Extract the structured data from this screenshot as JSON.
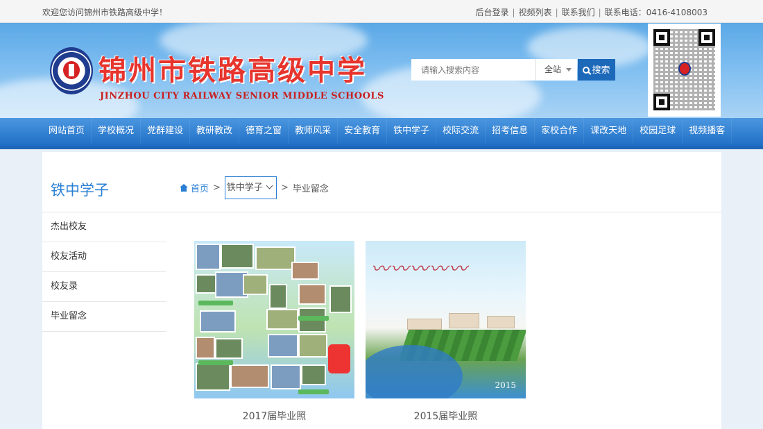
{
  "topbar": {
    "welcome": "欢迎您访问锦州市铁路高级中学！",
    "links": [
      "后台登录",
      "视频列表",
      "联系我们",
      "联系电话：0416-4108003"
    ]
  },
  "header": {
    "school_name": "锦州市铁路高级中学",
    "school_name_en": "JINZHOU CITY RAILWAY SENIOR MIDDLE SCHOOLS"
  },
  "search": {
    "placeholder": "请输入搜索内容",
    "scope": "全站",
    "button_label": "搜索"
  },
  "nav": {
    "items": [
      "网站首页",
      "学校概况",
      "党群建设",
      "教研教改",
      "德育之窗",
      "教师风采",
      "安全教育",
      "铁中学子",
      "校际交流",
      "招考信息",
      "家校合作",
      "课改天地",
      "校园足球",
      "视频播客"
    ]
  },
  "sidebar": {
    "title": "铁中学子",
    "items": [
      "杰出校友",
      "校友活动",
      "校友录",
      "毕业留念"
    ]
  },
  "breadcrumb": {
    "home": "首页",
    "section": "铁中学子",
    "current": "毕业留念"
  },
  "gallery": {
    "items": [
      {
        "caption": "2017届毕业照"
      },
      {
        "caption": "2015届毕业照"
      }
    ]
  },
  "colors": {
    "nav_blue": "#1f6fc6",
    "accent_blue": "#2a7fd4",
    "title_red": "#e7352e"
  }
}
